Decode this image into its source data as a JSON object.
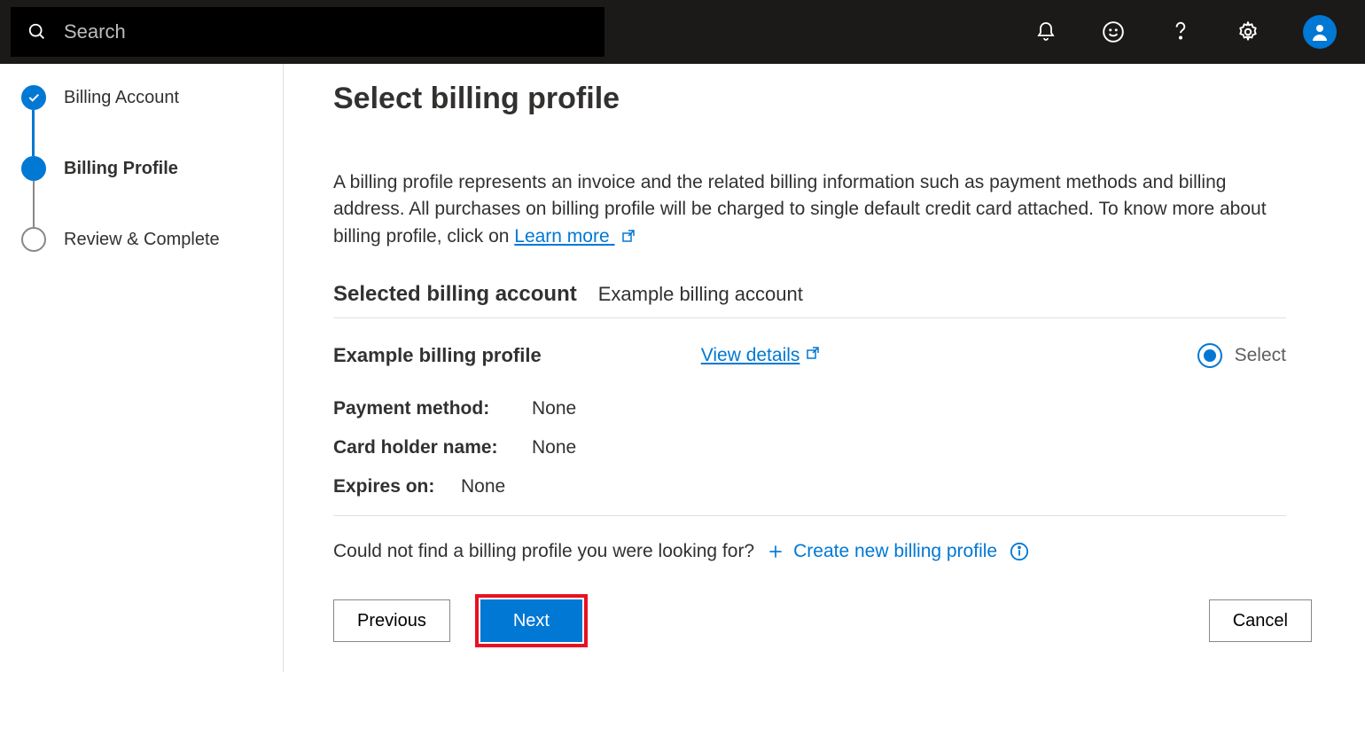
{
  "topbar": {
    "search_placeholder": "Search"
  },
  "stepper": {
    "steps": [
      {
        "label": "Billing Account",
        "state": "done"
      },
      {
        "label": "Billing Profile",
        "state": "current"
      },
      {
        "label": "Review & Complete",
        "state": "pending"
      }
    ]
  },
  "main": {
    "title": "Select billing profile",
    "description_prefix": "A billing profile represents an invoice and the related billing information such as payment methods and billing address. All purchases on billing profile will be charged to single default credit card attached. To know more about billing profile, click on ",
    "learn_more_label": "Learn more",
    "selected_account_label": "Selected billing account",
    "selected_account_value": "Example billing account",
    "profile": {
      "name": "Example billing profile",
      "view_details_label": "View details",
      "select_label": "Select",
      "selected": true,
      "fields": {
        "payment_method_label": "Payment method:",
        "payment_method_value": "None",
        "card_holder_label": "Card holder name:",
        "card_holder_value": "None",
        "expires_label": "Expires on:",
        "expires_value": "None"
      }
    },
    "not_found_text": "Could not find a billing profile you were looking for?",
    "create_new_label": "Create new billing profile"
  },
  "buttons": {
    "previous": "Previous",
    "next": "Next",
    "cancel": "Cancel"
  },
  "colors": {
    "primary": "#0078d4",
    "danger": "#e81123"
  }
}
